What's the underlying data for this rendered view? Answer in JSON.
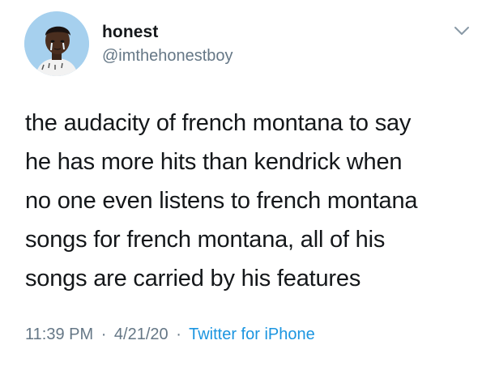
{
  "tweet": {
    "display_name": "honest",
    "handle": "@imthehonestboy",
    "text": "the audacity of french montana to say\nhe has more hits than kendrick when\nno one even listens to french montana\nsongs for french montana, all of his\nsongs are carried by his features",
    "time": "11:39 PM",
    "date": "4/21/20",
    "separator": "·",
    "source": "Twitter for iPhone"
  },
  "icons": {
    "menu": "chevron-down-icon",
    "avatar": "avatar"
  },
  "colors": {
    "text": "#14171a",
    "secondary": "#657786",
    "link": "#1b95e0",
    "avatar_bg": "#a6d0ee"
  }
}
